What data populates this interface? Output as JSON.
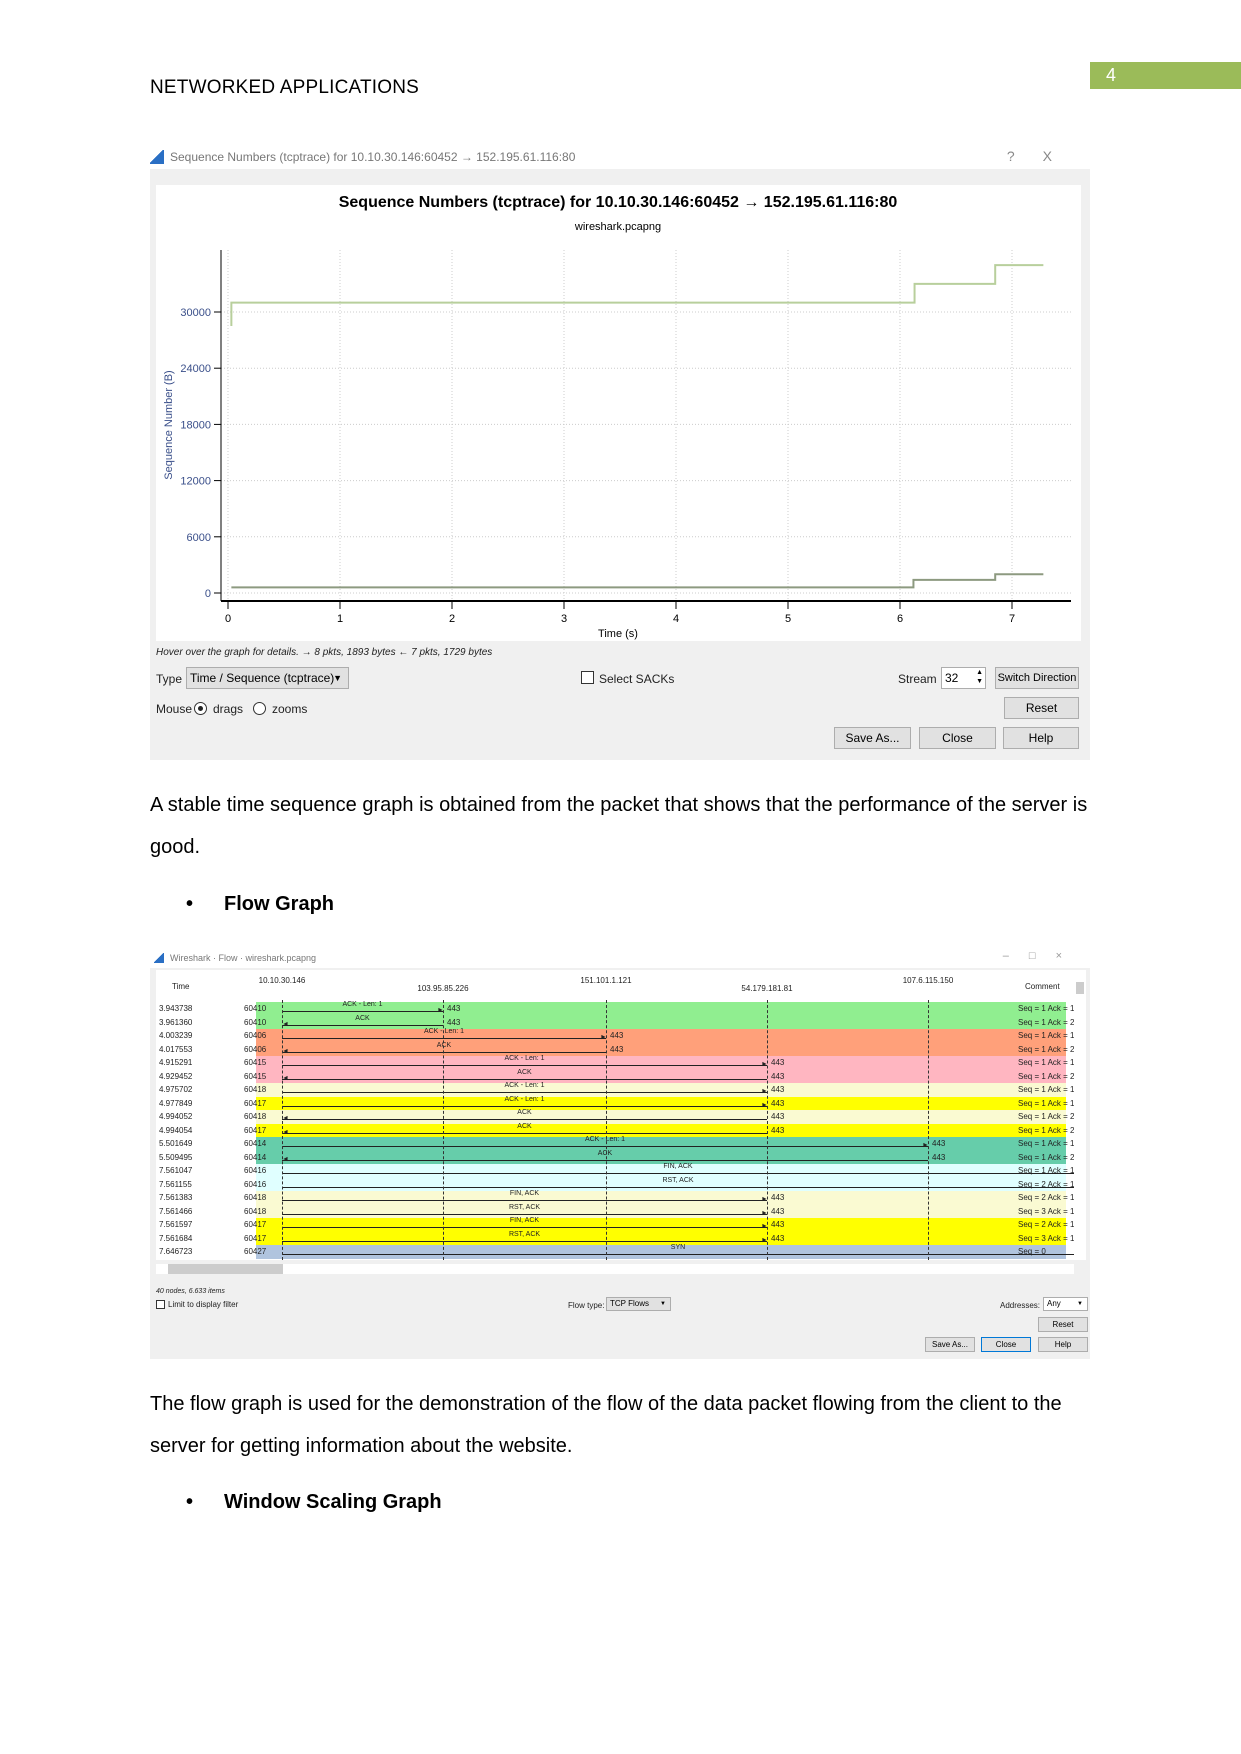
{
  "page": {
    "header": "NETWORKED APPLICATIONS",
    "page_number": "4",
    "accent": "#9bbb59"
  },
  "tcptrace": {
    "window_title": "Sequence Numbers (tcptrace) for 10.10.30.146:60452 → 152.195.61.116:80",
    "help_icon": "?",
    "close_icon": "X",
    "status": "Hover over the graph for details. → 8 pkts, 1893 bytes ← 7 pkts, 1729 bytes",
    "type_label": "Type",
    "type_value": "Time / Sequence (tcptrace)",
    "select_sacks": "Select SACKs",
    "stream_label": "Stream",
    "stream_value": "32",
    "switch_direction": "Switch Direction",
    "mouse_label": "Mouse",
    "drags": "drags",
    "zooms": "zooms",
    "reset": "Reset",
    "save_as": "Save As...",
    "close": "Close",
    "help": "Help"
  },
  "chart_data": {
    "type": "line",
    "title": "Sequence Numbers (tcptrace) for 10.10.30.146:60452 → 152.195.61.116:80",
    "subtitle": "wireshark.pcapng",
    "xlabel": "Time (s)",
    "ylabel": "Sequence Number (B)",
    "xlim": [
      0,
      7.4
    ],
    "ylim": [
      0,
      35500
    ],
    "xticks": [
      0,
      1,
      2,
      3,
      4,
      5,
      6,
      7
    ],
    "yticks": [
      0,
      6000,
      12000,
      18000,
      24000,
      30000
    ],
    "grid": true,
    "series": [
      {
        "color": "#b8cf9c",
        "step": true,
        "x": [
          0.03,
          0.03,
          6.13,
          6.85,
          7.28
        ],
        "y": [
          28500,
          31000,
          33000,
          35000,
          35000
        ]
      },
      {
        "color": "#8d9a80",
        "step": true,
        "x": [
          0.03,
          6.12,
          6.85,
          7.28
        ],
        "y": [
          600,
          1400,
          2000,
          2000
        ]
      }
    ]
  },
  "para1": "A stable time sequence graph is obtained from the packet that shows that the performance of the server is good.",
  "bullet1": "Flow Graph",
  "flow": {
    "window_title": "Wireshark · Flow · wireshark.pcapng",
    "time_header": "Time",
    "comment_header": "Comment",
    "nodes": [
      "10.10.30.146",
      "103.95.85.226",
      "151.101.1.121",
      "54.179.181.81",
      "107.6.115.150"
    ],
    "rows": [
      {
        "time": "3.943738",
        "port": "60410",
        "label": "ACK - Len: 1",
        "from": 0,
        "to": 1,
        "dport": "443",
        "comment": "Seq = 1 Ack = 1",
        "color": "#90ee90"
      },
      {
        "time": "3.961360",
        "port": "60410",
        "label": "ACK",
        "from": 1,
        "to": 0,
        "dport": "443",
        "comment": "Seq = 1 Ack = 2",
        "color": "#90ee90"
      },
      {
        "time": "4.003239",
        "port": "60406",
        "label": "ACK - Len: 1",
        "from": 0,
        "to": 2,
        "dport": "443",
        "comment": "Seq = 1 Ack = 1",
        "color": "#ffa07a"
      },
      {
        "time": "4.017553",
        "port": "60406",
        "label": "ACK",
        "from": 2,
        "to": 0,
        "dport": "443",
        "comment": "Seq = 1 Ack = 2",
        "color": "#ffa07a"
      },
      {
        "time": "4.915291",
        "port": "60415",
        "label": "ACK - Len: 1",
        "from": 0,
        "to": 3,
        "dport": "443",
        "comment": "Seq = 1 Ack = 1",
        "color": "#ffb6c1"
      },
      {
        "time": "4.929452",
        "port": "60415",
        "label": "ACK",
        "from": 3,
        "to": 0,
        "dport": "443",
        "comment": "Seq = 1 Ack = 2",
        "color": "#ffb6c1"
      },
      {
        "time": "4.975702",
        "port": "60418",
        "label": "ACK - Len: 1",
        "from": 0,
        "to": 3,
        "dport": "443",
        "comment": "Seq = 1 Ack = 1",
        "color": "#fafad2"
      },
      {
        "time": "4.977849",
        "port": "60417",
        "label": "ACK - Len: 1",
        "from": 0,
        "to": 3,
        "dport": "443",
        "comment": "Seq = 1 Ack = 1",
        "color": "#ffff00"
      },
      {
        "time": "4.994052",
        "port": "60418",
        "label": "ACK",
        "from": 3,
        "to": 0,
        "dport": "443",
        "comment": "Seq = 1 Ack = 2",
        "color": "#fafad2"
      },
      {
        "time": "4.994054",
        "port": "60417",
        "label": "ACK",
        "from": 3,
        "to": 0,
        "dport": "443",
        "comment": "Seq = 1 Ack = 2",
        "color": "#ffff00"
      },
      {
        "time": "5.501649",
        "port": "60414",
        "label": "ACK - Len: 1",
        "from": 0,
        "to": 4,
        "dport": "443",
        "comment": "Seq = 1 Ack = 1",
        "color": "#66cdaa"
      },
      {
        "time": "5.509495",
        "port": "60414",
        "label": "ACK",
        "from": 4,
        "to": 0,
        "dport": "443",
        "comment": "Seq = 1 Ack = 2",
        "color": "#66cdaa"
      },
      {
        "time": "7.561047",
        "port": "60416",
        "label": "FIN, ACK",
        "from": 0,
        "to": 5,
        "dport": "",
        "comment": "Seq = 1 Ack = 1",
        "color": "#e0ffff"
      },
      {
        "time": "7.561155",
        "port": "60416",
        "label": "RST, ACK",
        "from": 0,
        "to": 5,
        "dport": "",
        "comment": "Seq = 2 Ack = 1",
        "color": "#e0ffff"
      },
      {
        "time": "7.561383",
        "port": "60418",
        "label": "FIN, ACK",
        "from": 0,
        "to": 3,
        "dport": "443",
        "comment": "Seq = 2 Ack = 1",
        "color": "#fafad2"
      },
      {
        "time": "7.561466",
        "port": "60418",
        "label": "RST, ACK",
        "from": 0,
        "to": 3,
        "dport": "443",
        "comment": "Seq = 3 Ack = 1",
        "color": "#fafad2"
      },
      {
        "time": "7.561597",
        "port": "60417",
        "label": "FIN, ACK",
        "from": 0,
        "to": 3,
        "dport": "443",
        "comment": "Seq = 2 Ack = 1",
        "color": "#ffff00"
      },
      {
        "time": "7.561684",
        "port": "60417",
        "label": "RST, ACK",
        "from": 0,
        "to": 3,
        "dport": "443",
        "comment": "Seq = 3 Ack = 1",
        "color": "#ffff00"
      },
      {
        "time": "7.646723",
        "port": "60427",
        "label": "SYN",
        "from": 0,
        "to": 5,
        "dport": "",
        "comment": "Seq = 0",
        "color": "#b0c4de"
      }
    ],
    "status": "40 nodes, 6.633 items",
    "limit_filter": "Limit to display filter",
    "flow_type_label": "Flow type:",
    "flow_type_value": "TCP Flows",
    "addresses_label": "Addresses:",
    "addresses_value": "Any",
    "reset": "Reset",
    "save_as": "Save As...",
    "close": "Close",
    "help": "Help"
  },
  "para2": "The flow graph is used for the demonstration of the flow of the data packet flowing from the client to the server for getting information about the website.",
  "bullet2": "Window Scaling Graph"
}
